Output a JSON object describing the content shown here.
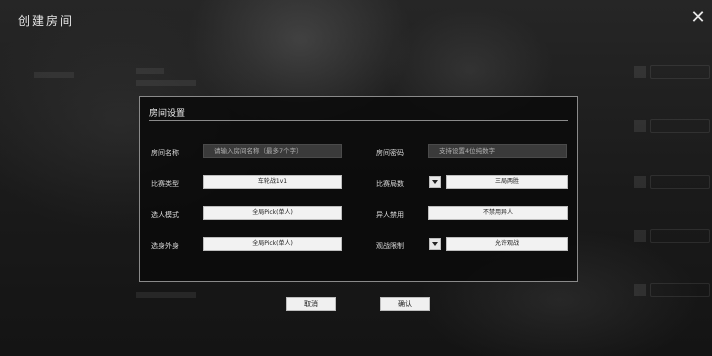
{
  "window": {
    "title": "创建房间"
  },
  "dialog": {
    "title": "房间设置",
    "fields": {
      "room_name": {
        "label": "房间名称",
        "placeholder": "请输入房间名称（最多7个字）"
      },
      "room_password": {
        "label": "房间密码",
        "placeholder": "支持设置4位纯数字"
      },
      "match_type": {
        "label": "比赛类型",
        "value": "车轮战1v1"
      },
      "match_rounds": {
        "label": "比赛局数",
        "value": "三局两胜"
      },
      "pick_mode": {
        "label": "选人模式",
        "value": "全局Pick(单人)"
      },
      "ban_mode": {
        "label": "异人禁用",
        "value": "不禁用异人"
      },
      "skin_mode": {
        "label": "选身外身",
        "value": "全局Pick(单人)"
      },
      "spectate": {
        "label": "观战限制",
        "value": "允许观战"
      }
    }
  },
  "buttons": {
    "cancel": "取消",
    "confirm": "确认"
  }
}
